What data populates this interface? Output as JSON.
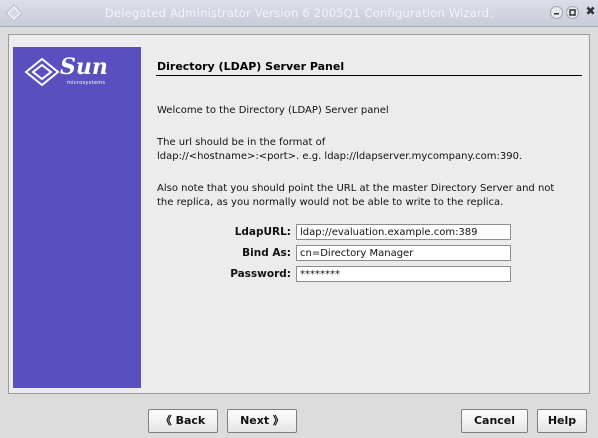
{
  "window": {
    "title": "Delegated Administrator Version 6 2005Q1 Configuration Wizard.",
    "close_glyph": "✖"
  },
  "sidebar": {
    "logo_text": "Sun",
    "logo_subtext": "microsystems",
    "color": "#5a4fbf"
  },
  "panel": {
    "title": "Directory (LDAP) Server Panel",
    "welcome": "Welcome to the Directory (LDAP) Server panel",
    "format_line1": "The url should  be in the format of",
    "format_line2": "ldap://<hostname>:<port>. e.g. ldap://ldapserver.mycompany.com:390.",
    "note_line1": "Also note that you should point the URL at the master Directory Server and not",
    "note_line2": "the replica, as you normally would not be able to write to the replica."
  },
  "form": {
    "ldapurl_label": "LdapURL:",
    "ldapurl_value": "ldap://evaluation.example.com:389",
    "bindas_label": "Bind As:",
    "bindas_value": "cn=Directory Manager",
    "password_label": "Password:",
    "password_value": "********"
  },
  "buttons": {
    "back": "《 Back",
    "next": "Next 》",
    "cancel": "Cancel",
    "help": "Help"
  }
}
